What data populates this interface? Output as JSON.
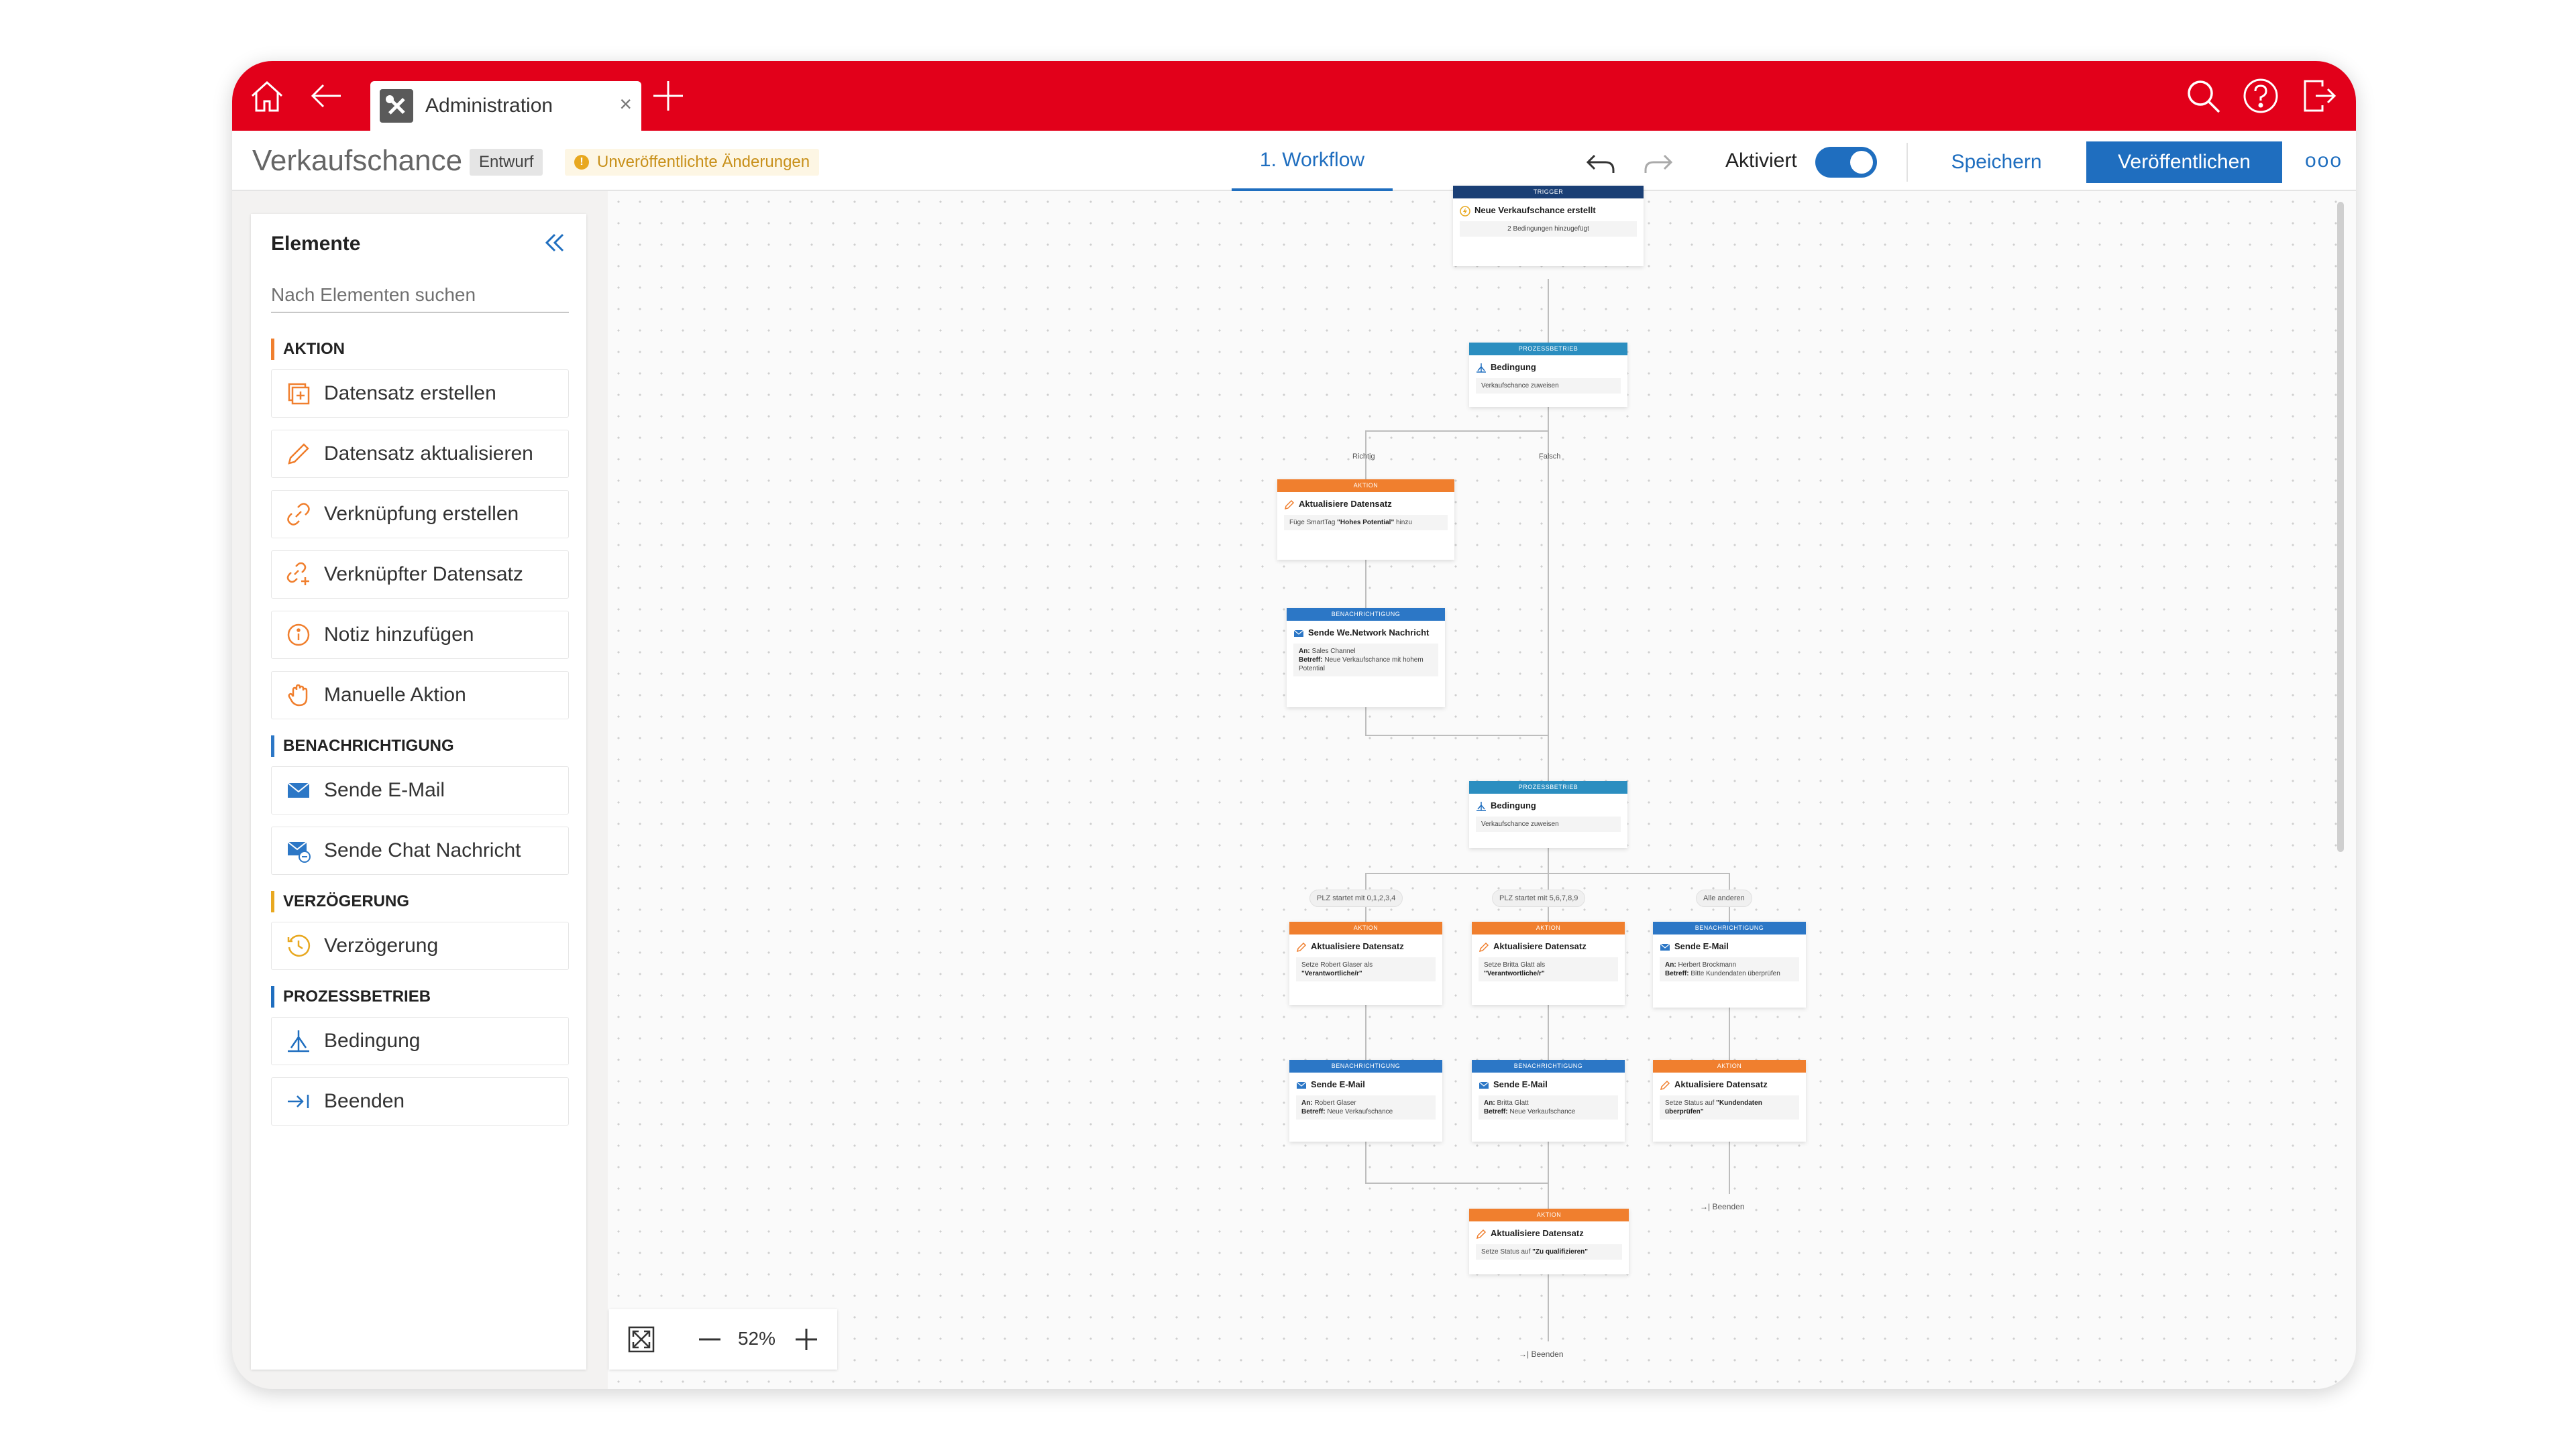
{
  "browser": {
    "tab_label": "Administration",
    "tab_close": "×",
    "icons": [
      "home-icon",
      "back-arrow-icon",
      "tools-icon",
      "new-tab-plus-icon",
      "search-icon",
      "help-icon",
      "logout-icon"
    ]
  },
  "header": {
    "title": "Verkaufschance",
    "status_badge": "Entwurf",
    "unpublished_note": "Unveröffentlichte Änderungen",
    "unpublished_icon": "!",
    "workflow_tab": "1. Workflow",
    "activated_label": "Aktiviert",
    "activated": true,
    "save_label": "Speichern",
    "publish_label": "Veröffentlichen",
    "more_label": "ooo",
    "accent_color": "#1f6ebf",
    "brand_color": "#e2001a"
  },
  "elements_panel": {
    "title": "Elemente",
    "search_placeholder": "Nach Elementen suchen",
    "sections": [
      {
        "title": "AKTION",
        "color": "#f07f2e",
        "items": [
          {
            "label": "Datensatz erstellen",
            "icon": "add-record-icon"
          },
          {
            "label": "Datensatz aktualisieren",
            "icon": "pencil-icon"
          },
          {
            "label": "Verknüpfung erstellen",
            "icon": "link-icon"
          },
          {
            "label": "Verknüpfter Datensatz",
            "icon": "linked-record-icon"
          },
          {
            "label": "Notiz hinzufügen",
            "icon": "info-icon"
          },
          {
            "label": "Manuelle Aktion",
            "icon": "hand-icon"
          }
        ]
      },
      {
        "title": "BENACHRICHTIGUNG",
        "color": "#2c77c6",
        "items": [
          {
            "label": "Sende E-Mail",
            "icon": "mail-icon"
          },
          {
            "label": "Sende Chat Nachricht",
            "icon": "chat-mail-icon"
          }
        ]
      },
      {
        "title": "VERZÖGERUNG",
        "color": "#e8a820",
        "items": [
          {
            "label": "Verzögerung",
            "icon": "clock-icon"
          }
        ]
      },
      {
        "title": "PROZESSBETRIEB",
        "color": "#1f6ebf",
        "items": [
          {
            "label": "Bedingung",
            "icon": "branch-icon"
          },
          {
            "label": "Beenden",
            "icon": "end-icon"
          }
        ]
      }
    ]
  },
  "zoom": {
    "value": "52%"
  },
  "workflow": {
    "trigger": {
      "header": "TRIGGER",
      "title": "Neue Verkaufschance erstellt",
      "detail": "2 Bedingungen hinzugefügt"
    },
    "condition1": {
      "header": "PROZESSBETRIEB",
      "title": "Bedingung",
      "detail": "Verkaufschance zuweisen"
    },
    "branch_true": "Richtig",
    "branch_false": "Falsch",
    "action_potential": {
      "header": "AKTION",
      "title": "Aktualisiere Datensatz",
      "detail_pre": "Füge SmartTag ",
      "detail_bold": "\"Hohes Potential\"",
      "detail_post": " hinzu"
    },
    "notify_we": {
      "header": "BENACHRICHTIGUNG",
      "title": "Sende We.Network Nachricht",
      "to_label": "An:",
      "to": "Sales Channel",
      "subject_label": "Betreff:",
      "subject": "Neue Verkaufschance mit hohem Potential"
    },
    "condition2": {
      "header": "PROZESSBETRIEB",
      "title": "Bedingung",
      "detail": "Verkaufschance zuweisen"
    },
    "branch_a": "PLZ startet mit 0,1,2,3,4",
    "branch_b": "PLZ startet mit 5,6,7,8,9",
    "branch_c": "Alle anderen",
    "action_a": {
      "header": "AKTION",
      "title": "Aktualisiere Datensatz",
      "detail": "Setze Robert Glaser als",
      "detail_bold": "\"Verantwortliche/r\""
    },
    "action_b": {
      "header": "AKTION",
      "title": "Aktualisiere Datensatz",
      "detail": "Setze Britta Glatt als",
      "detail_bold": "\"Verantwortliche/r\""
    },
    "mail_c": {
      "header": "BENACHRICHTIGUNG",
      "title": "Sende E-Mail",
      "to_label": "An:",
      "to": "Herbert Brockmann",
      "subject_label": "Betreff:",
      "subject": "Bitte Kundendaten überprüfen"
    },
    "mail_a": {
      "header": "BENACHRICHTIGUNG",
      "title": "Sende E-Mail",
      "to_label": "An:",
      "to": "Robert Glaser",
      "subject_label": "Betreff:",
      "subject": "Neue Verkaufschance"
    },
    "mail_b": {
      "header": "BENACHRICHTIGUNG",
      "title": "Sende E-Mail",
      "to_label": "An:",
      "to": "Britta Glatt",
      "subject_label": "Betreff:",
      "subject": "Neue Verkaufschance"
    },
    "action_c": {
      "header": "AKTION",
      "title": "Aktualisiere Datensatz",
      "detail": "Setze Status auf ",
      "detail_bold": "\"Kundendaten überprüfen\""
    },
    "end_c": "→| Beenden",
    "action_final": {
      "header": "AKTION",
      "title": "Aktualisiere Datensatz",
      "detail": "Setze Status auf ",
      "detail_bold": "\"Zu qualifizieren\""
    },
    "end_final": "→| Beenden"
  }
}
